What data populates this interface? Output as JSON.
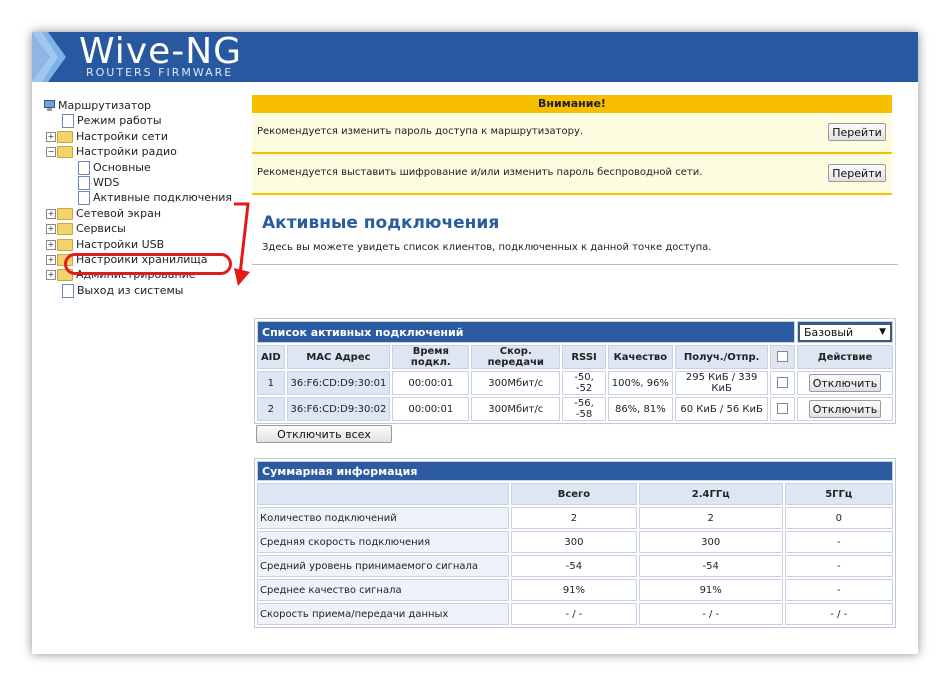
{
  "header": {
    "logo_title": "Wive-NG",
    "logo_subtitle": "ROUTERS FIRMWARE",
    "bg_color": "#2859a0"
  },
  "sidebar": {
    "root": "Маршрутизатор",
    "items": [
      {
        "label": "Режим работы"
      },
      {
        "label": "Настройки сети"
      },
      {
        "label": "Настройки радио"
      },
      {
        "label": "Основные"
      },
      {
        "label": "WDS"
      },
      {
        "label": "Активные подключения"
      },
      {
        "label": "Сетевой экран"
      },
      {
        "label": "Сервисы"
      },
      {
        "label": "Настройки USB"
      },
      {
        "label": "Настройки хранилища"
      },
      {
        "label": "Администрирование"
      },
      {
        "label": "Выход из системы"
      }
    ],
    "highlight_color": "#e01b1b"
  },
  "warning": {
    "title": "Внимание!",
    "rows": [
      {
        "text": "Рекомендуется изменить пароль доступа к маршрутизатору.",
        "button": "Перейти"
      },
      {
        "text": "Рекомендуется выставить шифрование и/или изменить пароль беспроводной сети.",
        "button": "Перейти"
      }
    ],
    "color": "#f7bf00"
  },
  "main": {
    "title": "Активные подключения",
    "description": "Здесь вы можете увидеть список клиентов, подключенных к данной точке доступа."
  },
  "connections": {
    "caption": "Список активных подключений",
    "mode_selected": "Базовый",
    "columns": [
      "AID",
      "MAC Адрес",
      "Время подкл.",
      "Скор. передачи",
      "RSSI",
      "Качество",
      "Получ./Отпр.",
      "",
      "Действие"
    ],
    "rows": [
      {
        "aid": "1",
        "mac": "36:F6:CD:D9:30:01",
        "time": "00:00:01",
        "rate": "300Мбит/с",
        "rssi": "-50, -52",
        "quality": "100%, 96%",
        "traffic": "295 КиБ / 339 КиБ",
        "action": "Отключить"
      },
      {
        "aid": "2",
        "mac": "36:F6:CD:D9:30:02",
        "time": "00:00:01",
        "rate": "300Мбит/с",
        "rssi": "-56, -58",
        "quality": "86%, 81%",
        "traffic": "60 КиБ / 56 КиБ",
        "action": "Отключить"
      }
    ],
    "disconnect_all": "Отключить всех"
  },
  "summary": {
    "caption": "Суммарная информация",
    "columns": [
      "",
      "Всего",
      "2.4ГГц",
      "5ГГц"
    ],
    "rows": [
      {
        "label": "Количество подключений",
        "total": "2",
        "g24": "2",
        "g5": "0"
      },
      {
        "label": "Средняя скорость подключения",
        "total": "300",
        "g24": "300",
        "g5": "-"
      },
      {
        "label": "Средний уровень принимаемого сигнала",
        "total": "-54",
        "g24": "-54",
        "g5": "-"
      },
      {
        "label": "Среднее качество сигнала",
        "total": "91%",
        "g24": "91%",
        "g5": "-"
      },
      {
        "label": "Скорость приема/передачи данных",
        "total": "- / -",
        "g24": "- / -",
        "g5": "- / -"
      }
    ]
  }
}
